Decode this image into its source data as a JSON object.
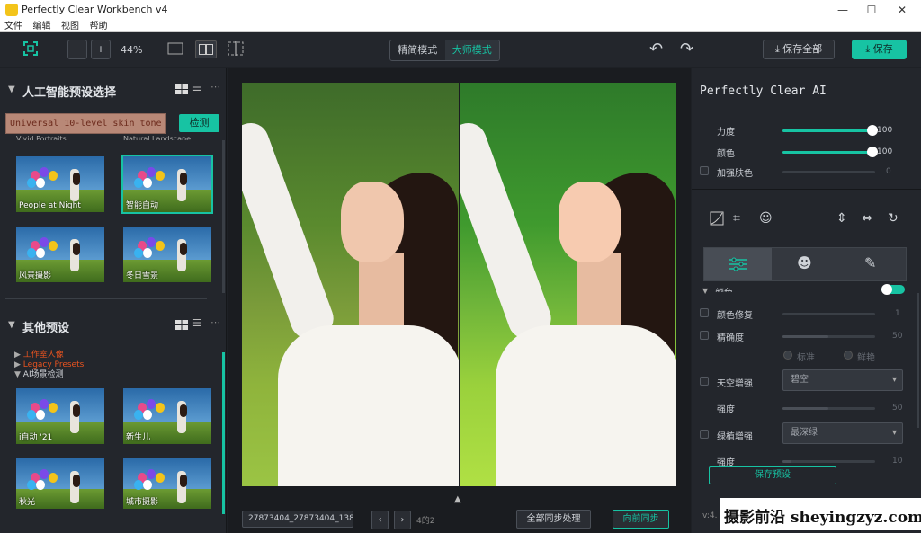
{
  "window": {
    "title": "Perfectly Clear Workbench v4",
    "min": "—",
    "max": "☐",
    "close": "✕"
  },
  "menu": [
    "文件",
    "编辑",
    "视图",
    "帮助"
  ],
  "toolbar": {
    "zoom": "44%",
    "zoom_out": "−",
    "zoom_in": "+",
    "simple_mode": "精简模式",
    "master_mode": "大师模式",
    "undo": "↶",
    "redo": "↷",
    "save_all": "保存全部",
    "save": "保存"
  },
  "left": {
    "ai_section": "人工智能预设选择",
    "search_value": "Universal 10-level skin tone",
    "detect": "检测",
    "cut_captions": [
      "Vivid Portraits",
      "Natural Landscape"
    ],
    "ai_thumbs": [
      "People at Night",
      "智能自动",
      "风景摄影",
      "冬日雪景"
    ],
    "other_section": "其他预设",
    "tree": [
      "工作室人像",
      "Legacy Presets",
      "AI场景检测"
    ],
    "other_thumbs": [
      "i自动 '21",
      "新生儿",
      "秋光",
      "城市摄影"
    ]
  },
  "center": {
    "file": "27873404_27873404_138",
    "page": "4的2",
    "sync_all": "全部同步处理",
    "sync_forward": "向前同步",
    "prev": "‹",
    "next": "›",
    "toggle": "▲"
  },
  "right": {
    "title": "Perfectly Clear AI",
    "strength_label": "力度",
    "strength_value": "100",
    "strength": 1.0,
    "color_label": "颜色",
    "color_value": "100",
    "color": 1.0,
    "skin_label": "加强肤色",
    "skin_value": "0",
    "section_label": "颜色",
    "color_fix_label": "颜色修复",
    "color_fix_value": "1",
    "vivid_label": "精确度",
    "vivid_value": "50",
    "radio_standard": "标准",
    "radio_vivid": "鲜艳",
    "sky_label": "天空增强",
    "sky_select": "碧空",
    "sky_strength_label": "强度",
    "sky_strength_value": "50",
    "foliage_label": "绿植增强",
    "foliage_select": "最深绿",
    "foliage_strength_label": "强度",
    "foliage_strength_value": "10",
    "save_preset": "保存预设",
    "version": "v:4.",
    "watermark": "摄影前沿 sheyingzyz.com"
  }
}
